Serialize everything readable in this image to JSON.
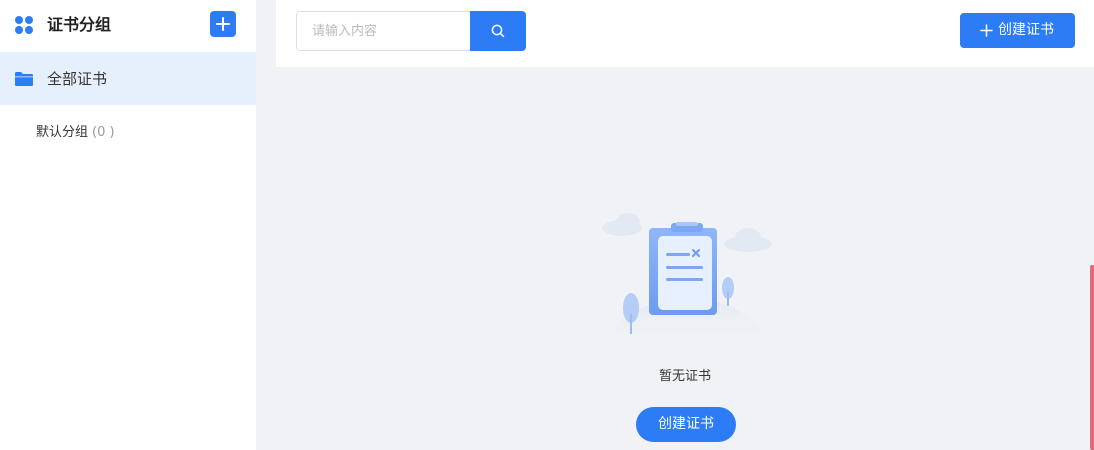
{
  "sidebar": {
    "title": "证书分组",
    "all_label": "全部证书",
    "groups": [
      {
        "label": "默认分组",
        "count": "(0 )"
      }
    ]
  },
  "search": {
    "placeholder": "请输入内容",
    "value": ""
  },
  "toolbar": {
    "create_label": "创建证书"
  },
  "empty_state": {
    "message": "暂无证书",
    "button_label": "创建证书"
  },
  "icons": {
    "group": "grid-dots-icon",
    "add": "plus-icon",
    "folder": "folder-icon",
    "search": "search-icon"
  },
  "colors": {
    "accent": "#2b7cf5",
    "sidebar_active_bg": "#e6f0fd",
    "content_bg": "#f0f2f5"
  }
}
